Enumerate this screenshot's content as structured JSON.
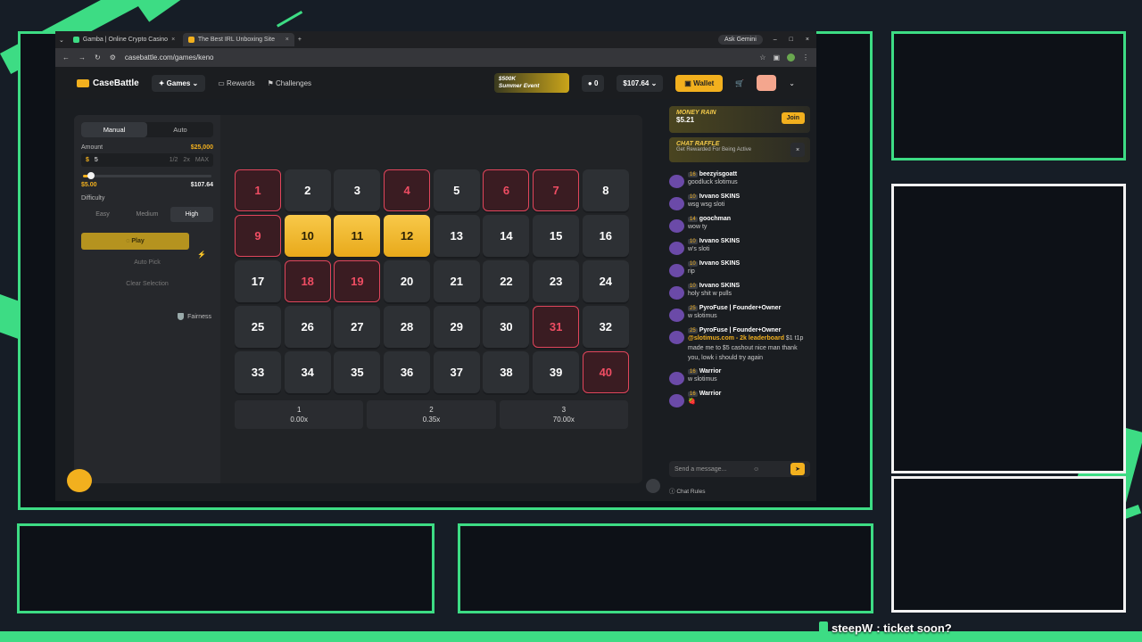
{
  "browser": {
    "tabs": [
      {
        "label": "Gamba | Online Crypto Casino"
      },
      {
        "label": "The Best IRL Unboxing Site"
      }
    ],
    "gemini": "Ask Gemini",
    "url": "casebattle.com/games/keno"
  },
  "site": {
    "brand": "CaseBattle",
    "nav": {
      "games": "Games",
      "rewards": "Rewards",
      "challenges": "Challenges"
    },
    "promo": {
      "line1": "$500K",
      "line2": "Summer Event"
    },
    "coins": "0",
    "balance": "$107.64",
    "wallet": "Wallet"
  },
  "side": {
    "tabs": [
      "Manual",
      "Auto"
    ],
    "amount_label": "Amount",
    "amount_max": "$25,000",
    "bet_value": "5",
    "currency": "$",
    "quick": [
      "1/2",
      "2x",
      "MAX"
    ],
    "slider_min": "$5.00",
    "slider_max": "$107.64",
    "slider_fraction": 0.046,
    "difficulty_label": "Difficulty",
    "difficulty": [
      "Easy",
      "Medium",
      "High"
    ],
    "play": "Play",
    "auto_pick": "Auto Pick",
    "clear": "Clear Selection",
    "fairness": "Fairness"
  },
  "board": {
    "numbers": [
      "1",
      "2",
      "3",
      "4",
      "5",
      "6",
      "7",
      "8",
      "9",
      "10",
      "11",
      "12",
      "13",
      "14",
      "15",
      "16",
      "17",
      "18",
      "19",
      "20",
      "21",
      "22",
      "23",
      "24",
      "25",
      "26",
      "27",
      "28",
      "29",
      "30",
      "31",
      "32",
      "33",
      "34",
      "35",
      "36",
      "37",
      "38",
      "39",
      "40"
    ],
    "selected": [
      "1",
      "4",
      "6",
      "7",
      "9",
      "18",
      "19",
      "31",
      "40"
    ],
    "hits": [
      "10",
      "11",
      "12"
    ],
    "payouts": [
      {
        "hits": "1",
        "mult": "0.00x"
      },
      {
        "hits": "2",
        "mult": "0.35x"
      },
      {
        "hits": "3",
        "mult": "70.00x"
      }
    ]
  },
  "chat": {
    "money_rain": {
      "title": "MONEY RAIN",
      "amount": "$5.21",
      "join": "Join"
    },
    "raffle": {
      "title": "CHAT RAFFLE",
      "sub": "Get Rewarded For Being Active"
    },
    "messages": [
      {
        "level": "16",
        "user": "beezyisgoatt",
        "text": "goodluck slotimus",
        "mention": ""
      },
      {
        "level": "10",
        "user": "Ivvano SKINS",
        "text": "wsg wsg sloti",
        "mention": ""
      },
      {
        "level": "14",
        "user": "goochman",
        "text": "wow ty",
        "mention": ""
      },
      {
        "level": "10",
        "user": "Ivvano SKINS",
        "text": "w's sloti",
        "mention": ""
      },
      {
        "level": "10",
        "user": "Ivvano SKINS",
        "text": "rip",
        "mention": ""
      },
      {
        "level": "10",
        "user": "Ivvano SKINS",
        "text": "holy shit w pulls",
        "mention": ""
      },
      {
        "level": "25",
        "user": "PyroFuse | Founder+Owner",
        "text": "w slotimus",
        "mention": ""
      },
      {
        "level": "25",
        "user": "PyroFuse | Founder+Owner",
        "text": " $1 t1p made me to $5 cashout nice man thank you, lowk i should try again",
        "mention": "@slotimus.com - 2k leaderboard"
      },
      {
        "level": "16",
        "user": "Warrior",
        "text": "w slotimus",
        "mention": ""
      },
      {
        "level": "16",
        "user": "Warrior",
        "text": "🍓",
        "mention": ""
      }
    ],
    "placeholder": "Send a message...",
    "rules": "Chat Rules"
  },
  "ticker": {
    "user": "steepW",
    "text": ": ticket soon?"
  }
}
